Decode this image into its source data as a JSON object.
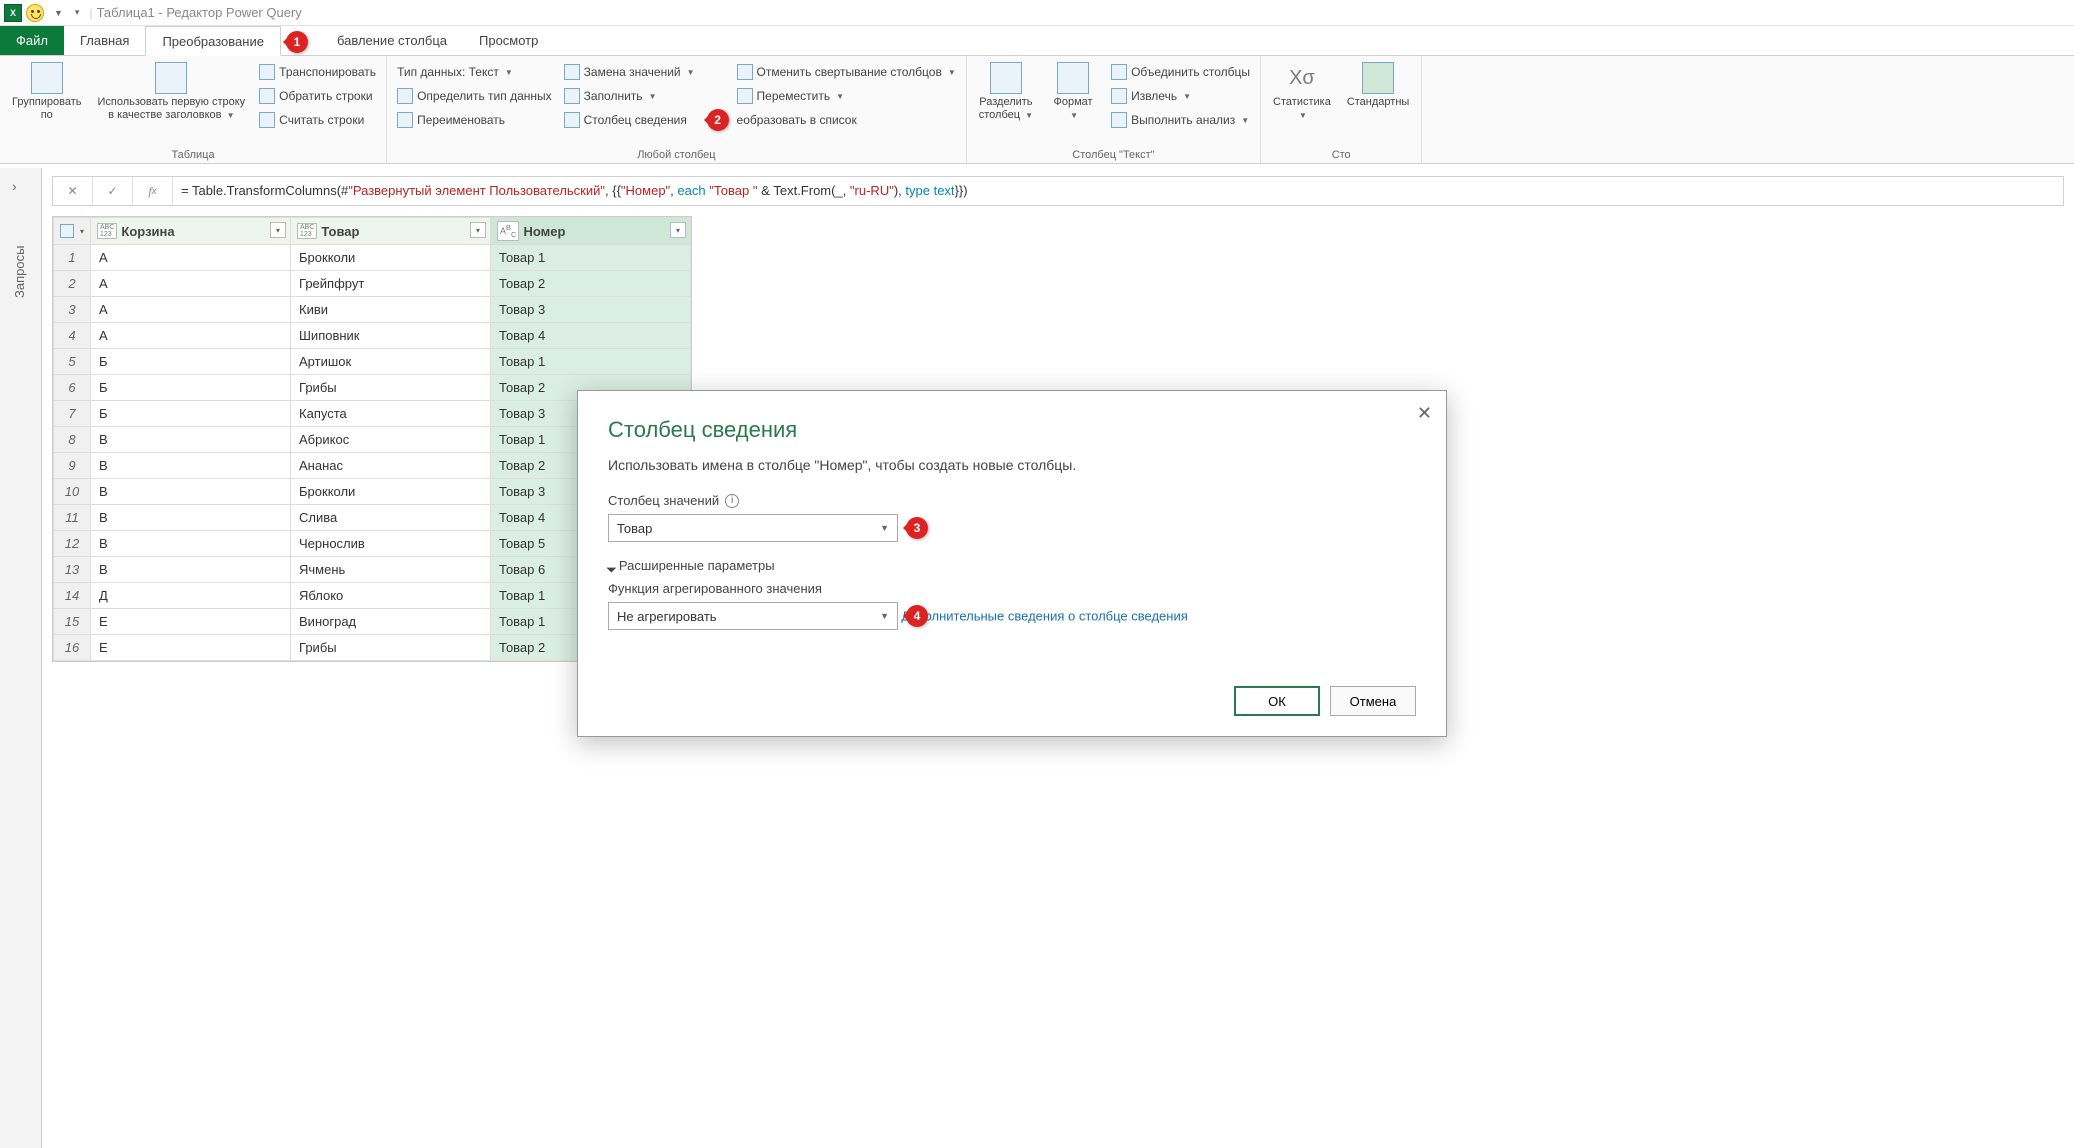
{
  "titlebar": {
    "excel_abbrev": "X",
    "title": "Таблица1 - Редактор Power Query"
  },
  "tabs": {
    "file": "Файл",
    "home": "Главная",
    "transform": "Преобразование",
    "addcolumn": "бавление столбца",
    "view": "Просмотр"
  },
  "callouts": {
    "c1": "1",
    "c2": "2",
    "c3": "3",
    "c4": "4"
  },
  "ribbon": {
    "table": {
      "group_by": "Группировать\nпо",
      "use_first_row": "Использовать первую строку\nв качестве заголовков",
      "transpose": "Транспонировать",
      "reverse": "Обратить строки",
      "count": "Считать строки",
      "label": "Таблица"
    },
    "anycol": {
      "datatype": "Тип данных: Текст",
      "detect": "Определить тип данных",
      "rename": "Переименовать",
      "replace": "Замена значений",
      "fill": "Заполнить",
      "pivot": "Столбец сведения",
      "unpivot": "Отменить свертывание столбцов",
      "move": "Переместить",
      "tolist": "еобразовать в список",
      "label": "Любой столбец"
    },
    "textcol": {
      "split": "Разделить\nстолбец",
      "format": "Формат",
      "merge": "Объединить столбцы",
      "extract": "Извлечь",
      "analyze": "Выполнить анализ",
      "label": "Столбец \"Текст\""
    },
    "numcol": {
      "stats": "Статистика",
      "standard": "Стандартны",
      "label": "Сто"
    }
  },
  "queries_pane": {
    "label": "Запросы"
  },
  "formula": {
    "prefix": "= Table.TransformColumns(#",
    "arg1": "\"Развернутый элемент Пользовательский\"",
    "mid1": ", {{",
    "arg2": "\"Номер\"",
    "mid2": ", ",
    "each": "each",
    "sp1": " ",
    "arg3": "\"Товар \"",
    "mid3": " & Text.From(_, ",
    "arg4": "\"ru-RU\"",
    "mid4": "), ",
    "type": "type",
    "sp2": " ",
    "text": "text",
    "end": "}})"
  },
  "grid": {
    "headers": {
      "korzina": "Корзина",
      "tovar": "Товар",
      "nomer": "Номер"
    },
    "type_any": "ABC\n123",
    "type_text": "A",
    "rows": [
      {
        "n": "1",
        "k": "А",
        "t": "Брокколи",
        "m": "Товар 1"
      },
      {
        "n": "2",
        "k": "А",
        "t": "Грейпфрут",
        "m": "Товар 2"
      },
      {
        "n": "3",
        "k": "А",
        "t": "Киви",
        "m": "Товар 3"
      },
      {
        "n": "4",
        "k": "А",
        "t": "Шиповник",
        "m": "Товар 4"
      },
      {
        "n": "5",
        "k": "Б",
        "t": "Артишок",
        "m": "Товар 1"
      },
      {
        "n": "6",
        "k": "Б",
        "t": "Грибы",
        "m": "Товар 2"
      },
      {
        "n": "7",
        "k": "Б",
        "t": "Капуста",
        "m": "Товар 3"
      },
      {
        "n": "8",
        "k": "В",
        "t": "Абрикос",
        "m": "Товар 1"
      },
      {
        "n": "9",
        "k": "В",
        "t": "Ананас",
        "m": "Товар 2"
      },
      {
        "n": "10",
        "k": "В",
        "t": "Брокколи",
        "m": "Товар 3"
      },
      {
        "n": "11",
        "k": "В",
        "t": "Слива",
        "m": "Товар 4"
      },
      {
        "n": "12",
        "k": "В",
        "t": "Чернослив",
        "m": "Товар 5"
      },
      {
        "n": "13",
        "k": "В",
        "t": "Ячмень",
        "m": "Товар 6"
      },
      {
        "n": "14",
        "k": "Д",
        "t": "Яблоко",
        "m": "Товар 1"
      },
      {
        "n": "15",
        "k": "Е",
        "t": "Виноград",
        "m": "Товар 1"
      },
      {
        "n": "16",
        "k": "Е",
        "t": "Грибы",
        "m": "Товар 2"
      }
    ]
  },
  "dialog": {
    "title": "Столбец сведения",
    "desc": "Использовать имена в столбце \"Номер\", чтобы создать новые столбцы.",
    "values_label": "Столбец значений",
    "values_selected": "Товар",
    "advanced": "Расширенные параметры",
    "agg_label": "Функция агрегированного значения",
    "agg_selected": "Не агрегировать",
    "learn_more": "Дополнительные сведения о столбце сведения",
    "ok": "ОК",
    "cancel": "Отмена"
  }
}
